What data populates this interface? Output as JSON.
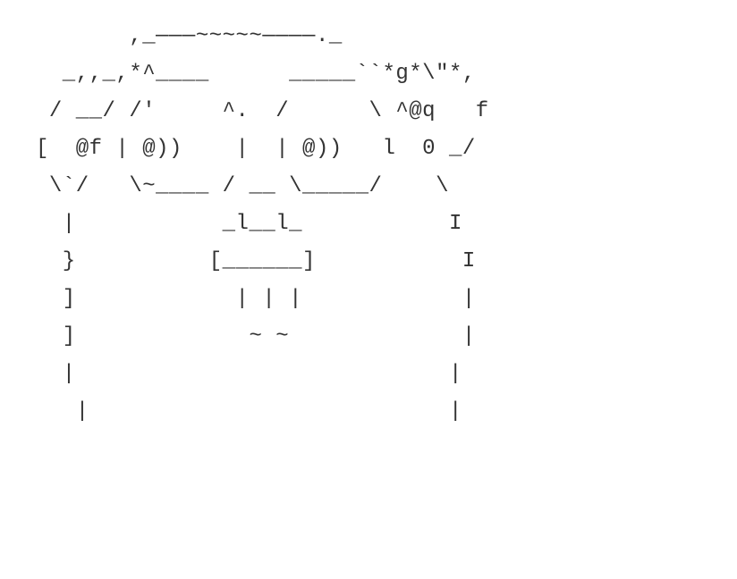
{
  "ascii": {
    "lines": [
      "       ,_———~~~~~————._",
      "  _,,_,*^____      _____``*g*\\\"*,",
      " / __/ /'     ^.  /      \\ ^@q   f",
      "[  @f | @))    |  | @))   l  0 _/",
      " \\`/   \\~____ / __ \\_____/    \\",
      "  |           _l__l_           I",
      "  }          [______]           I",
      "  ]            | | |            |",
      "  ]             ~ ~             |",
      "  |                            |",
      "   |                           |"
    ]
  }
}
